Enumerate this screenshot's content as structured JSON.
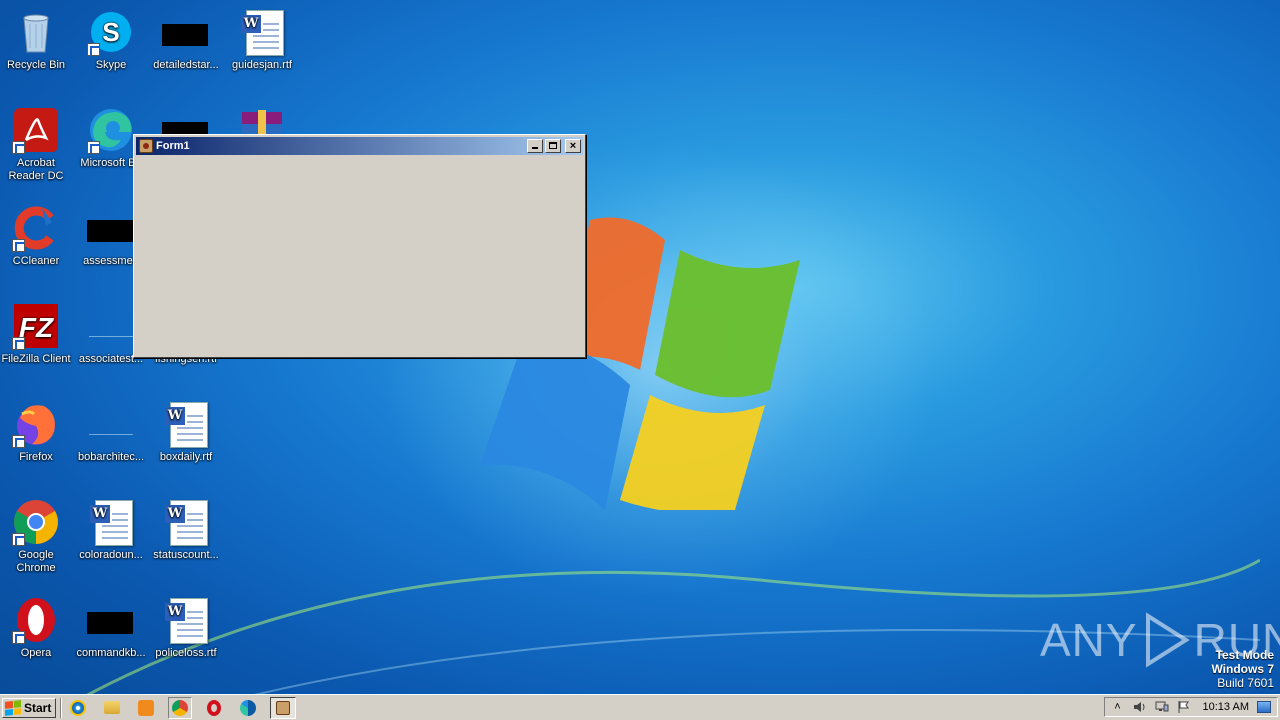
{
  "desktop": {
    "icons": [
      {
        "label": "Recycle Bin",
        "icon": "recycle-bin-icon"
      },
      {
        "label": "Skype",
        "icon": "skype-icon"
      },
      {
        "label": "detailedstar...",
        "icon": "redacted-icon"
      },
      {
        "label": "guidesjan.rtf",
        "icon": "word-document-icon"
      },
      {
        "label": "Acrobat Reader DC",
        "icon": "acrobat-reader-icon"
      },
      {
        "label": "Microsoft Ed",
        "icon": "edge-icon"
      },
      {
        "label": "",
        "icon": "redacted-icon"
      },
      {
        "label": "",
        "icon": "winrar-icon"
      },
      {
        "label": "CCleaner",
        "icon": "ccleaner-icon"
      },
      {
        "label": "assessmen",
        "icon": "redacted-icon"
      },
      {
        "label": "FileZilla Client",
        "icon": "filezilla-icon"
      },
      {
        "label": "associatest...",
        "icon": "blank-file-icon"
      },
      {
        "label": "fishingsen.rtf",
        "icon": "word-document-icon"
      },
      {
        "label": "Firefox",
        "icon": "firefox-icon"
      },
      {
        "label": "bobarchitec...",
        "icon": "blank-file-icon"
      },
      {
        "label": "boxdaily.rtf",
        "icon": "word-document-icon"
      },
      {
        "label": "Google Chrome",
        "icon": "chrome-icon"
      },
      {
        "label": "coloradoun...",
        "icon": "word-document-icon"
      },
      {
        "label": "statuscount...",
        "icon": "word-document-icon"
      },
      {
        "label": "Opera",
        "icon": "opera-icon"
      },
      {
        "label": "commandkb...",
        "icon": "redacted-icon"
      },
      {
        "label": "policeloss.rtf",
        "icon": "word-document-icon"
      }
    ]
  },
  "window": {
    "title": "Form1",
    "icon": "delphi-app-icon",
    "buttons": {
      "minimize": "minimize-icon",
      "maximize": "maximize-icon",
      "close": "×"
    }
  },
  "taskbar": {
    "start_label": "Start",
    "quicklaunch": [
      "ie-icon",
      "explorer-icon",
      "media-player-icon",
      "chrome-icon",
      "opera-icon",
      "edge-icon"
    ],
    "active_task": "Form1",
    "tray": {
      "time": "10:13 AM"
    }
  },
  "watermark": {
    "left": "ANY",
    "right": "RUN",
    "test_mode": "Test Mode",
    "os": "Windows 7",
    "build": "Build 7601"
  },
  "colors": {
    "title_gradient_start": "#0a246a",
    "title_gradient_end": "#a6caf0",
    "window_face": "#d4d0c8",
    "desktop_blue": "#1677cf"
  }
}
